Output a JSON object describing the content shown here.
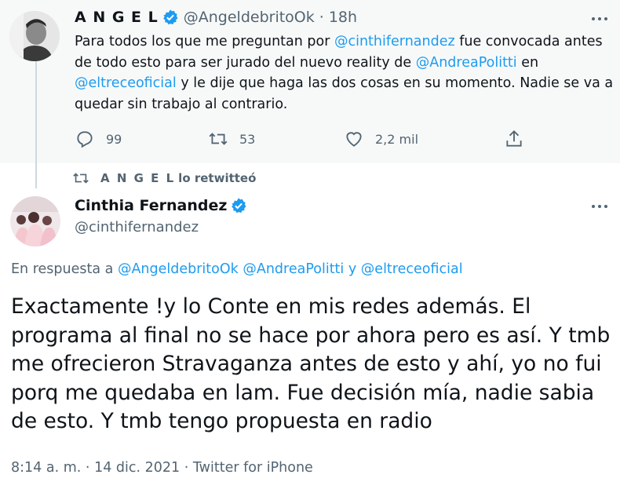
{
  "parent_tweet": {
    "author_name": "A N G E L",
    "handle": "@AngeldebritoOk",
    "separator": "·",
    "time": "18h",
    "text_parts": [
      {
        "t": "Para todos los que me preguntan por ",
        "link": false
      },
      {
        "t": "@cinthifernandez",
        "link": true
      },
      {
        "t": " fue convocada antes de todo esto para ser jurado del nuevo reality de ",
        "link": false
      },
      {
        "t": "@AndreaPolitti",
        "link": true
      },
      {
        "t": " en ",
        "link": false
      },
      {
        "t": "@eltreceoficial",
        "link": true
      },
      {
        "t": " y le dije que haga las dos cosas en su momento. Nadie se va a quedar sin trabajo al contrario.",
        "link": false
      }
    ],
    "replies": "99",
    "retweets": "53",
    "likes": "2,2 mil"
  },
  "retweet_context": {
    "name": "A N G E L",
    "label": "lo retwitteó"
  },
  "main_tweet": {
    "author_name": "Cinthia Fernandez",
    "handle": "@cinthifernandez",
    "reply_prefix": "En respuesta a",
    "reply_to": [
      "@AngeldebritoOk",
      "@AndreaPolitti"
    ],
    "reply_conj": "y",
    "reply_last": "@eltreceoficial",
    "text": "Exactamente !y lo Conte en mis redes además. El programa al final no se hace por ahora pero es así. Y tmb me ofrecieron Stravaganza antes de esto y ahí, yo no fui porq me quedaba en lam. Fue decisión mía, nadie sabia de esto. Y tmb tengo propuesta en radio",
    "time": "8:14 a. m.",
    "date": "14 dic. 2021",
    "source": "Twitter for iPhone",
    "dot": "·"
  },
  "colors": {
    "accent": "#1d9bf0",
    "muted": "#536471",
    "text": "#0f1419",
    "parent_bg": "#f7f9f9"
  },
  "icons": [
    "verified-badge-icon",
    "more-icon",
    "reply-icon",
    "retweet-icon",
    "like-icon",
    "share-icon"
  ]
}
